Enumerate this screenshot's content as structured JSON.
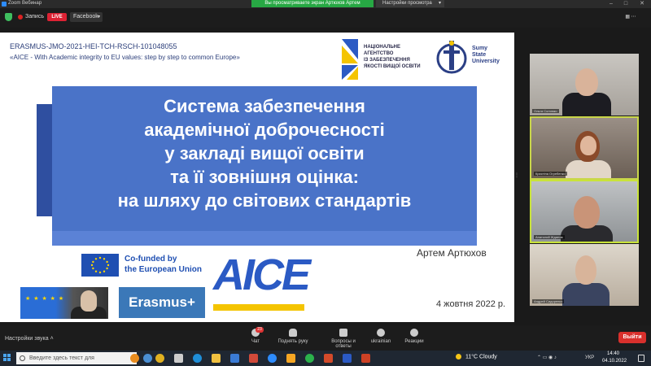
{
  "window": {
    "title": "Zoom Вебинар",
    "share_banner": "Вы просматриваете экран Артюхов Артем",
    "view_options": "Настройки просмотра",
    "controls": [
      "–",
      "□",
      "✕"
    ]
  },
  "top_toolbar": {
    "record_label": "Запись",
    "live_label": "LIVE",
    "facebook_label": "Facebook"
  },
  "slide": {
    "erasmus_code": "ERASMUS-JMO-2021-HEI-TCH-RSCH-101048055",
    "project_title": "«AICE - With Academic integrity to EU values: step by step to common Europe»",
    "nazyavo_lines": [
      "НАЦІОНАЛЬНЕ",
      "АГЕНТСТВО",
      "ІЗ ЗАБЕЗПЕЧЕННЯ",
      "ЯКОСТІ ВИЩОЇ ОСВІТИ"
    ],
    "sumy_lines": [
      "Sumy",
      "State",
      "University"
    ],
    "title_lines": [
      "Система забезпечення",
      "академічної доброчесності",
      "у закладі вищої освіти",
      "та її зовнішня оцінка:",
      "на шляху до світових стандартів"
    ],
    "author": "Артем Артюхов",
    "date": "4 жовтня 2022 р.",
    "eu_lines": [
      "Co-funded by",
      "the European Union"
    ],
    "erasmus_logo": "Erasmus+",
    "aice_logo": "AICE"
  },
  "participants": [
    {
      "name": "Ольга Соломко"
    },
    {
      "name": "Кристіна Огребенко"
    },
    {
      "name": "Анатолий Жданов"
    },
    {
      "name": "Андрей Сидоренко"
    }
  ],
  "bottom_toolbar": {
    "audio_settings": "Настройки звука",
    "chat_badge": "23",
    "buttons": [
      "Чат",
      "Поднять руку",
      "Вопросы и ответы",
      "ukrainian",
      "Реакции"
    ],
    "leave": "Выйти"
  },
  "taskbar": {
    "search_placeholder": "Введите здесь текст для",
    "weather": "11°C  Cloudy",
    "lang": "УКР",
    "time": "14:40",
    "date": "04.10.2022"
  },
  "colors": {
    "title_box": "#4a73c8",
    "leave_button": "#d9302c",
    "share_banner": "#27a844",
    "active_speaker": "#c9e33a"
  }
}
